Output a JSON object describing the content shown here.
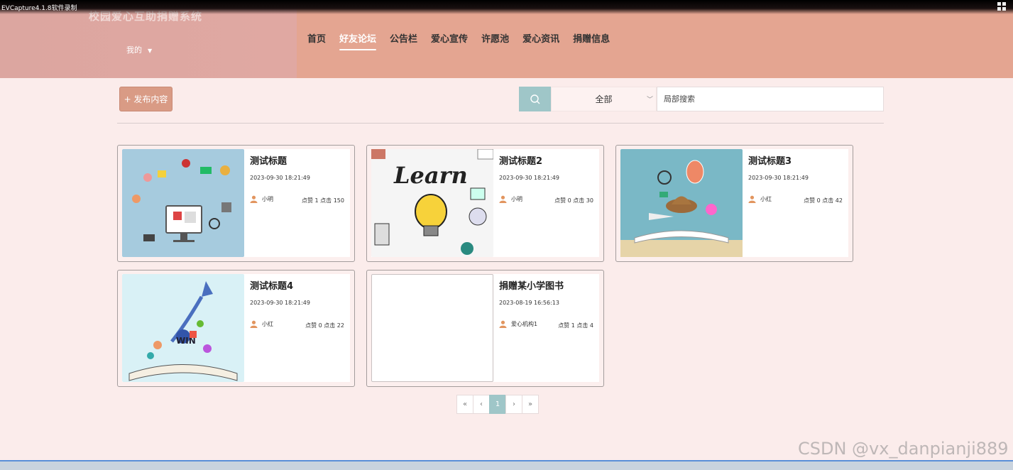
{
  "recorder": {
    "label": "EVCapture4.1.8软件录制"
  },
  "header": {
    "site_title": "校园爱心互助捐赠系统",
    "my_menu": "我的",
    "nav": [
      "首页",
      "好友论坛",
      "公告栏",
      "爱心宣传",
      "许愿池",
      "爱心资讯",
      "捐赠信息"
    ],
    "active_nav": "好友论坛"
  },
  "toolbar": {
    "publish_label": "+ 发布内容",
    "select_value": "全部",
    "search_placeholder": "局部搜索"
  },
  "cards": [
    {
      "title": "测试标题",
      "date": "2023-09-30 18:21:49",
      "author": "小明",
      "stats": "点赞 1 点击 150",
      "image": "ecommerce-illustration"
    },
    {
      "title": "测试标题2",
      "date": "2023-09-30 18:21:49",
      "author": "小明",
      "stats": "点赞 0 点击 30",
      "image": "learn-lightbulb-illustration"
    },
    {
      "title": "测试标题3",
      "date": "2023-09-30 18:21:49",
      "author": "小红",
      "stats": "点赞 0 点击 42",
      "image": "open-book-travel-illustration"
    },
    {
      "title": "测试标题4",
      "date": "2023-09-30 18:21:49",
      "author": "小红",
      "stats": "点赞 0 点击 22",
      "image": "book-rocket-win-illustration"
    },
    {
      "title": "捐赠某小学图书",
      "date": "2023-08-19 16:56:13",
      "author": "爱心机构1",
      "stats": "点赞 1 点击 4",
      "image": ""
    }
  ],
  "pagination": {
    "first": "«",
    "prev": "‹",
    "current": "1",
    "next": "›",
    "last": "»"
  },
  "watermark": "CSDN @vx_danpianji889",
  "colors": {
    "header": "#e4a591",
    "accent": "#9fc6c8",
    "publish": "#d99b85",
    "page_bg": "#fbeceb"
  }
}
